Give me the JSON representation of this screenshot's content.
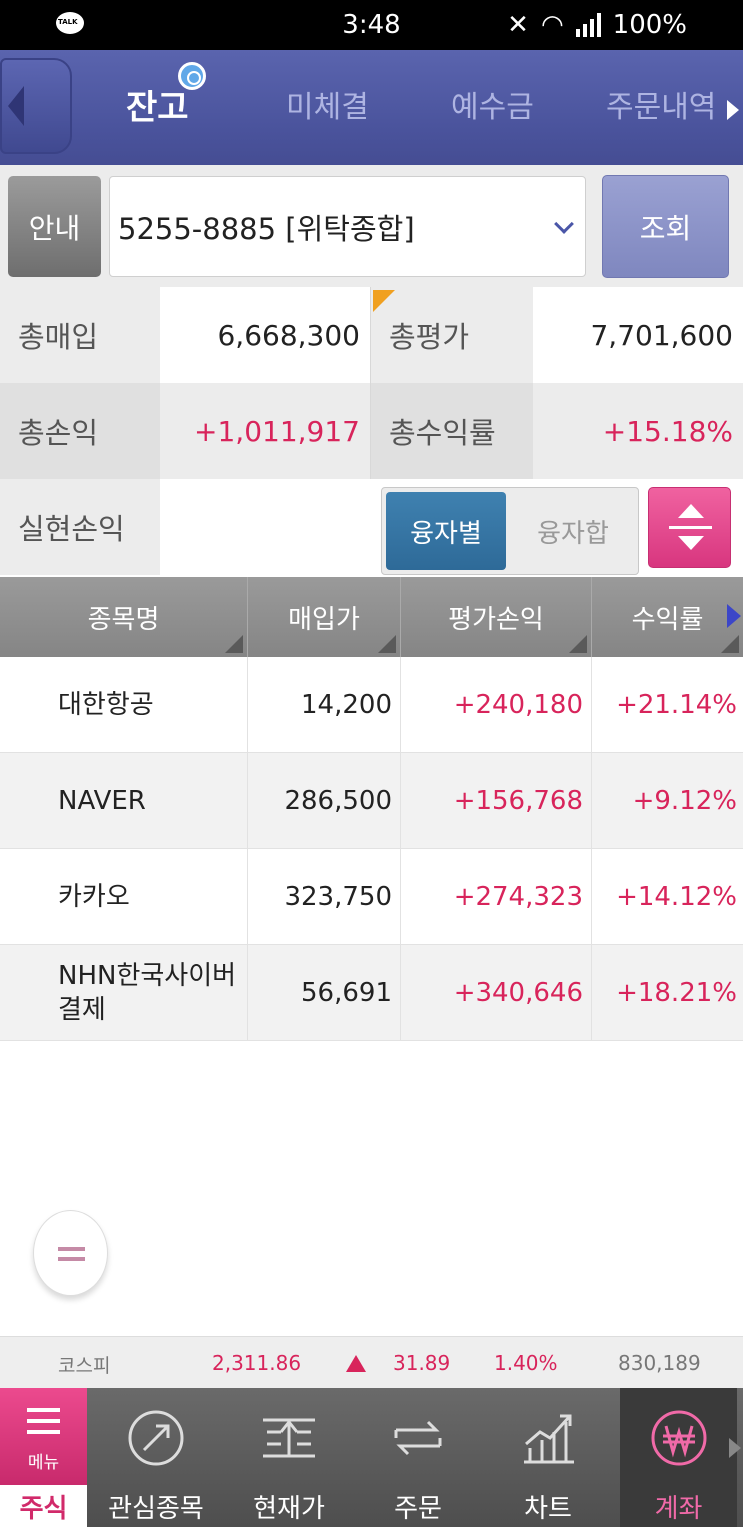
{
  "status_bar": {
    "time": "3:48",
    "battery": "100%",
    "kakao_badge": "TALK"
  },
  "tabs": [
    {
      "label": "잔고",
      "active": true
    },
    {
      "label": "미체결",
      "active": false
    },
    {
      "label": "예수금",
      "active": false
    },
    {
      "label": "주문내역",
      "active": false
    }
  ],
  "account": {
    "guide_label": "안내",
    "selected": "5255-8885 [위탁종합]",
    "query_label": "조회"
  },
  "summary": {
    "total_purchase_label": "총매입",
    "total_purchase": "6,668,300",
    "total_eval_label": "총평가",
    "total_eval": "7,701,600",
    "total_pl_label": "총손익",
    "total_pl": "+1,011,917",
    "total_return_label": "총수익률",
    "total_return": "+15.18%",
    "realized_label": "실현손익",
    "realized": "",
    "toggle_on": "융자별",
    "toggle_off": "융자합"
  },
  "table": {
    "headers": [
      "종목명",
      "매입가",
      "평가손익",
      "수익률"
    ],
    "rows": [
      {
        "name": "대한항공",
        "price": "14,200",
        "pl": "+240,180",
        "rate": "+21.14%"
      },
      {
        "name": "NAVER",
        "price": "286,500",
        "pl": "+156,768",
        "rate": "+9.12%"
      },
      {
        "name": "카카오",
        "price": "323,750",
        "pl": "+274,323",
        "rate": "+14.12%"
      },
      {
        "name": "NHN한국사이버결제",
        "price": "56,691",
        "pl": "+340,646",
        "rate": "+18.21%"
      }
    ]
  },
  "ticker": {
    "index_name": "코스피",
    "value": "2,311.86",
    "change": "31.89",
    "percent": "1.40%",
    "volume": "830,189",
    "direction": "up"
  },
  "bottom_nav": {
    "menu_label": "메뉴",
    "stock_label": "주식",
    "items": [
      {
        "label": "관심종목",
        "icon": "watchlist-icon",
        "active": false
      },
      {
        "label": "현재가",
        "icon": "current-price-icon",
        "active": false
      },
      {
        "label": "주문",
        "icon": "order-icon",
        "active": false
      },
      {
        "label": "차트",
        "icon": "chart-icon",
        "active": false
      },
      {
        "label": "계좌",
        "icon": "won-account-icon",
        "active": true
      }
    ]
  },
  "colors": {
    "header_blue": "#4a539c",
    "gain_red": "#d8245b",
    "accent_pink": "#e03e84",
    "toggle_blue": "#3577a6"
  }
}
